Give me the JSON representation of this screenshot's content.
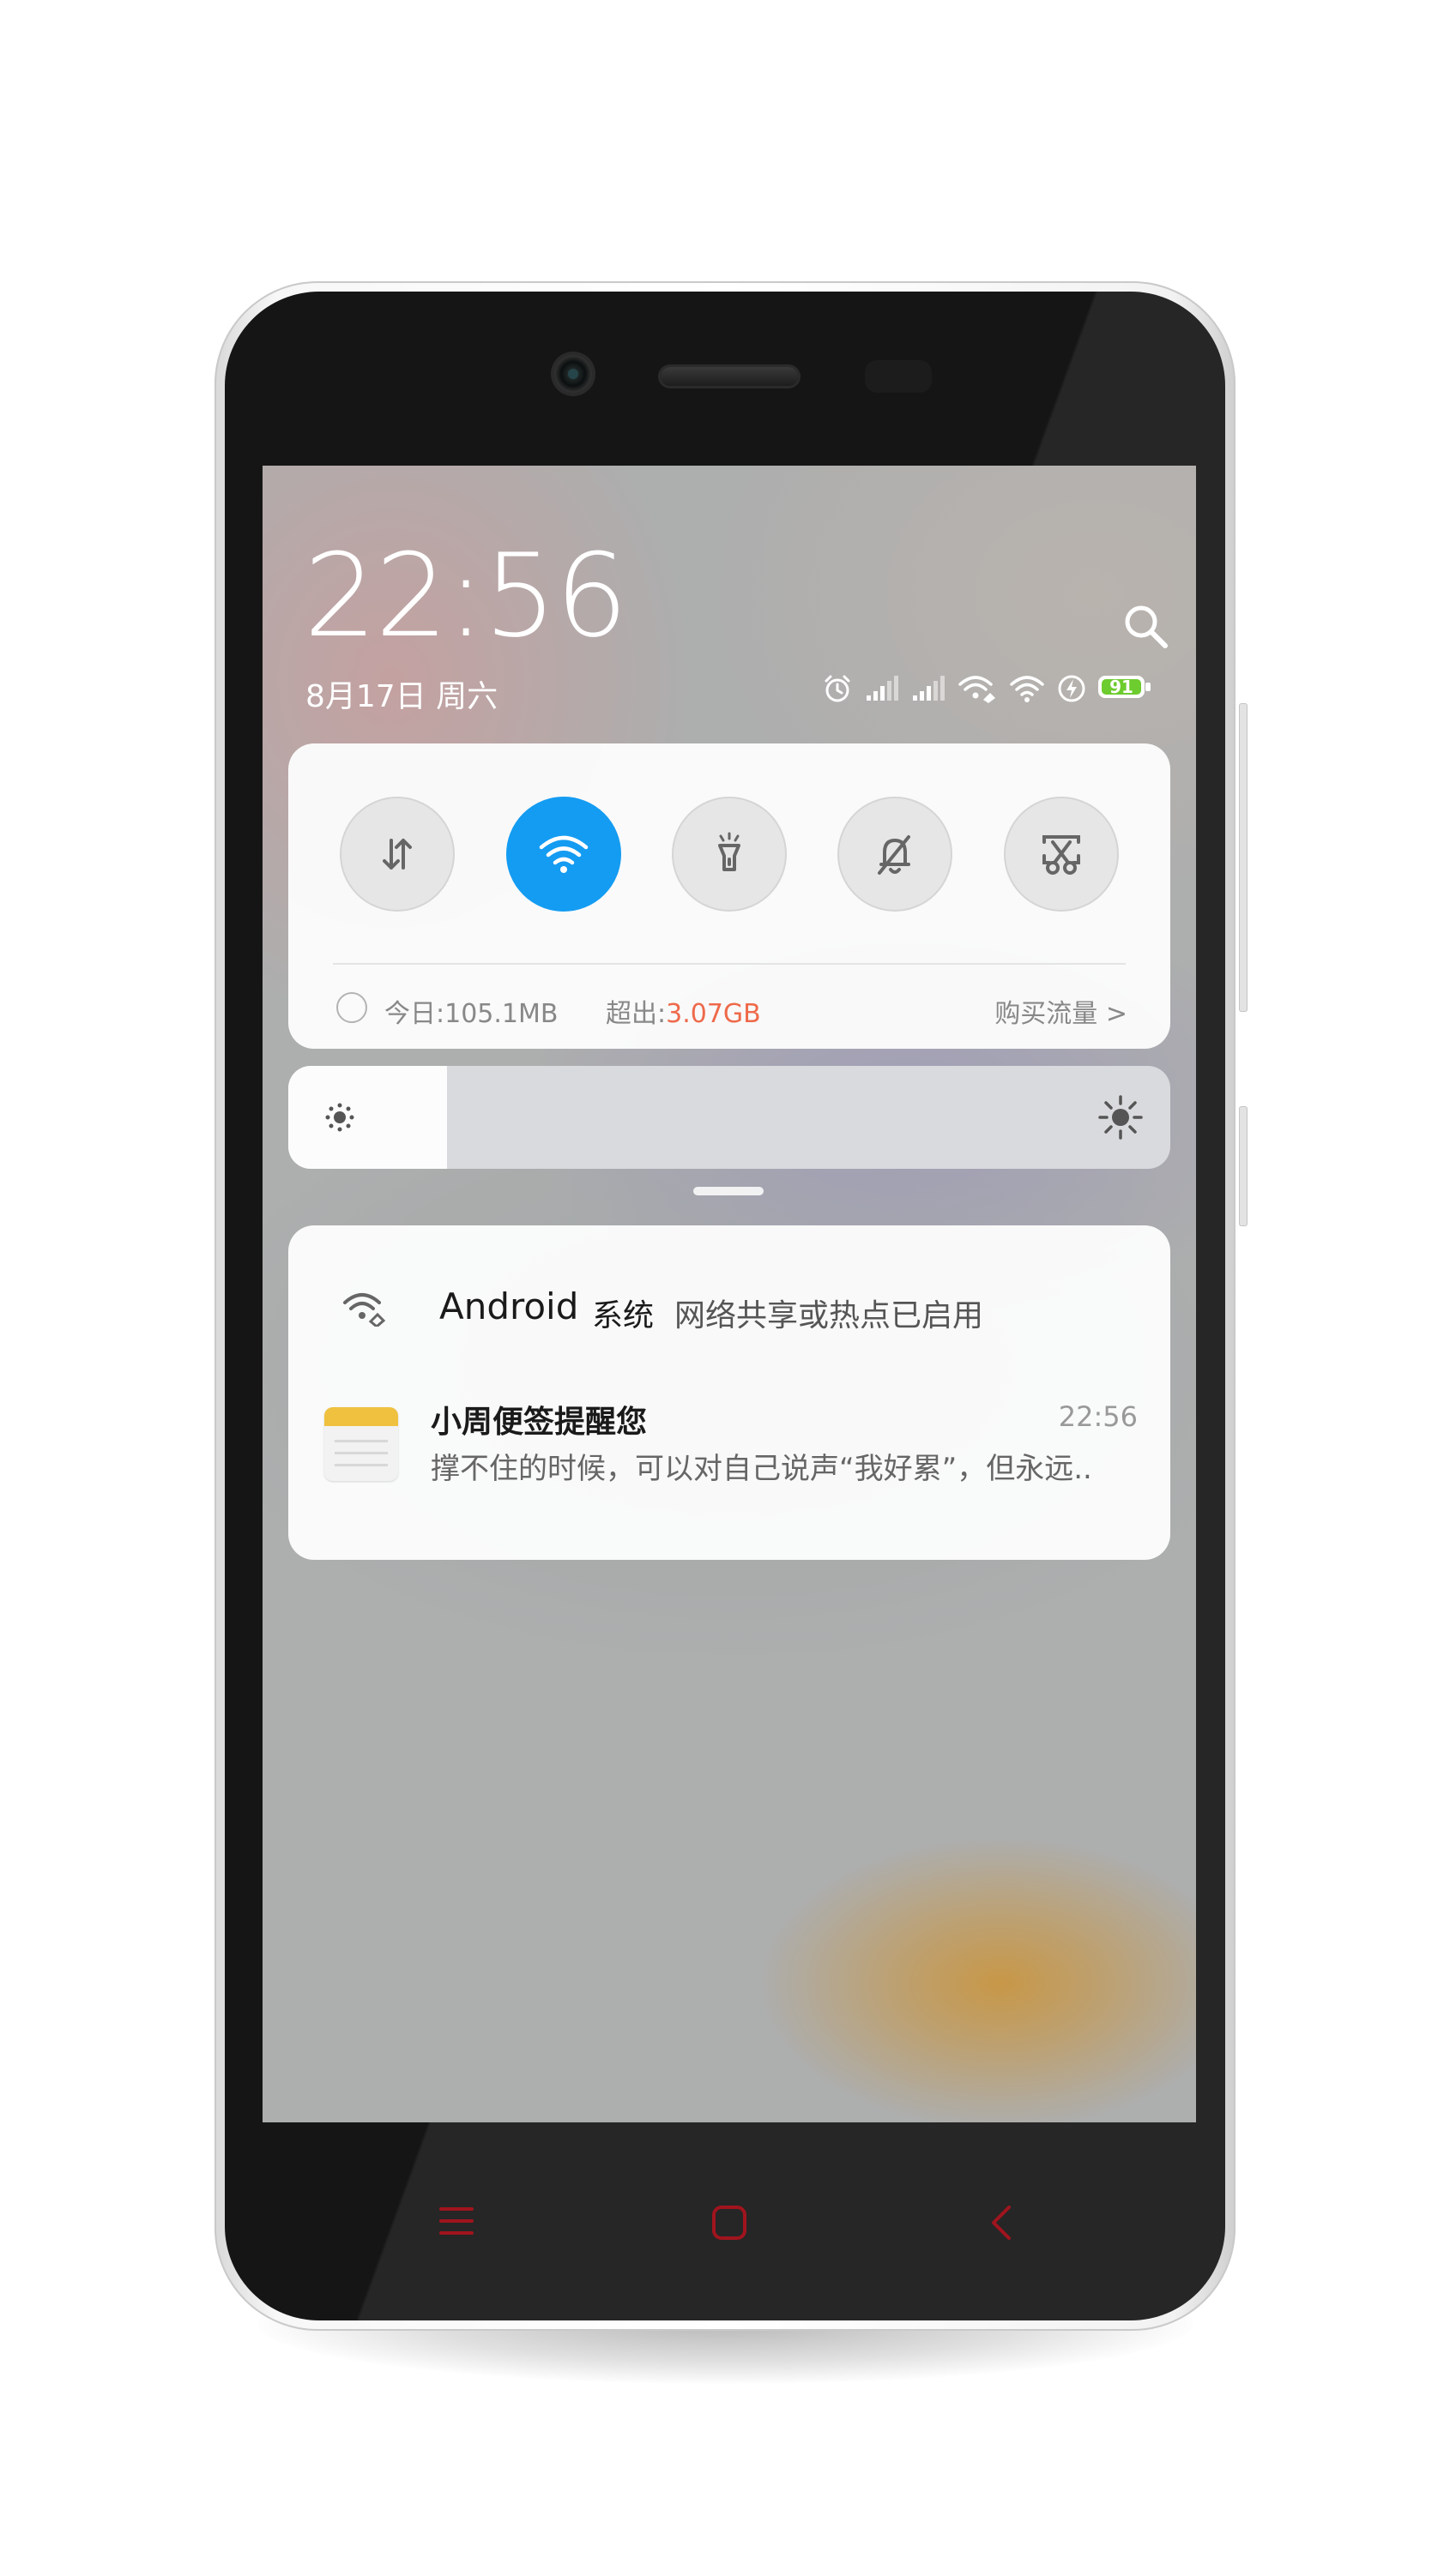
{
  "lockscreen": {
    "time": "22:56",
    "date": "8月17日 周六"
  },
  "status_bar": {
    "icons": [
      "alarm-icon",
      "signal-icon",
      "signal-icon",
      "hotspot-icon",
      "wifi-icon",
      "charging-icon"
    ],
    "battery_level": "91"
  },
  "quick_toggles": [
    {
      "name": "mobile-data",
      "icon": "data-arrows-icon",
      "active": false
    },
    {
      "name": "wifi",
      "icon": "wifi-icon",
      "active": true
    },
    {
      "name": "flashlight",
      "icon": "flashlight-icon",
      "active": false
    },
    {
      "name": "mute",
      "icon": "bell-off-icon",
      "active": false
    },
    {
      "name": "screenshot",
      "icon": "scissors-icon",
      "active": false
    }
  ],
  "data_usage": {
    "today": "今日:105.1MB",
    "over_label": "超出:",
    "over_value": "3.07GB",
    "buy_link": "购买流量 >"
  },
  "brightness": {
    "level": 0.18
  },
  "notifications": [
    {
      "app": "Android",
      "app_sub": "系统",
      "text": "网络共享或热点已启用"
    },
    {
      "title": "小周便签提醒您",
      "time": "22:56",
      "body": "撑不住的时候，可以对自己说声“我好累”，但永远.."
    }
  ],
  "colors": {
    "accent": "#149cf2",
    "warning": "#ee6a4a",
    "battery": "#6dcc2e",
    "nav_keys": "#a0141e"
  }
}
